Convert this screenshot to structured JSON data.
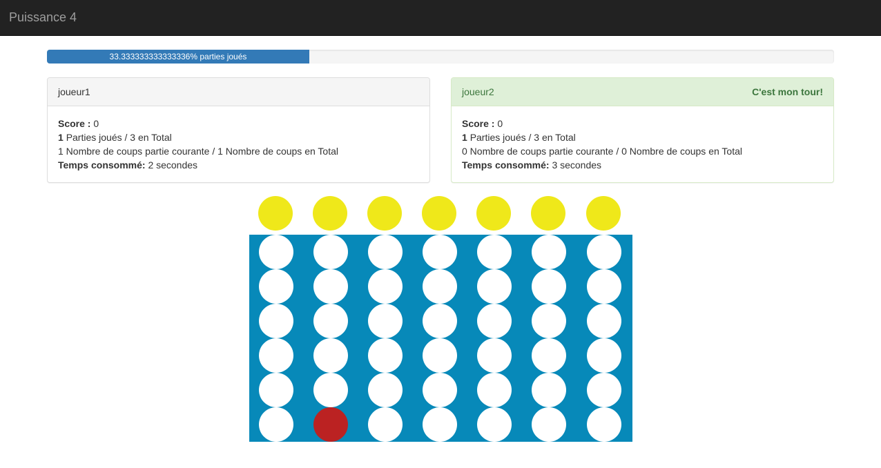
{
  "app": {
    "title": "Puissance 4"
  },
  "progress": {
    "label": "33.333333333333336% parties joués",
    "fraction": 0.3333,
    "color": "#337ab7"
  },
  "players": [
    {
      "name": "joueur1",
      "turn_label": "",
      "score_label": "Score :",
      "score": "0",
      "parties_count": "1",
      "parties_text": "Parties joués / 3 en Total",
      "coups_text": "1 Nombre de coups partie courante / 1 Nombre de coups en Total",
      "temps_label": "Temps consommé:",
      "temps_value": "2 secondes"
    },
    {
      "name": "joueur2",
      "turn_label": "C'est mon tour!",
      "score_label": "Score :",
      "score": "0",
      "parties_count": "1",
      "parties_text": "Parties joués / 3 en Total",
      "coups_text": "0 Nombre de coups partie courante / 0 Nombre de coups en Total",
      "temps_label": "Temps consommé:",
      "temps_value": "3 secondes"
    }
  ],
  "board": {
    "columns": 7,
    "rows": 6,
    "frame_color": "#0789b9",
    "empty_color": "#ffffff",
    "drop_token_color": "#efe81a",
    "player1_color": "#bb2222",
    "player2_color": "#efe81a",
    "cells": [
      [
        0,
        0,
        0,
        0,
        0,
        0,
        0
      ],
      [
        0,
        0,
        0,
        0,
        0,
        0,
        0
      ],
      [
        0,
        0,
        0,
        0,
        0,
        0,
        0
      ],
      [
        0,
        0,
        0,
        0,
        0,
        0,
        0
      ],
      [
        0,
        0,
        0,
        0,
        0,
        0,
        0
      ],
      [
        0,
        1,
        0,
        0,
        0,
        0,
        0
      ]
    ]
  }
}
